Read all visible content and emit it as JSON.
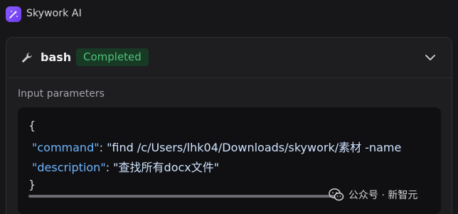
{
  "app": {
    "title": "Skywork AI"
  },
  "tool": {
    "name": "bash",
    "status": "Completed",
    "section_label": "Input parameters",
    "params": {
      "open": "{",
      "command_key": "\"command\"",
      "command_colon": ": ",
      "command_value": "\"find /c/Users/lhk04/Downloads/skywork/素材 -name",
      "description_key": "\"description\"",
      "description_colon": ": ",
      "description_value": "\"查找所有docx文件\"",
      "close": "}"
    }
  },
  "watermark": {
    "text": "公众号 · 新智元"
  },
  "colors": {
    "accent": "#7b4cf6",
    "status_bg": "#183a25",
    "status_text": "#4ec27a",
    "json_key": "#6eb4ff"
  },
  "icons": [
    "skywork-logo-icon",
    "wrench-icon",
    "chevron-down-icon",
    "wechat-icon"
  ]
}
